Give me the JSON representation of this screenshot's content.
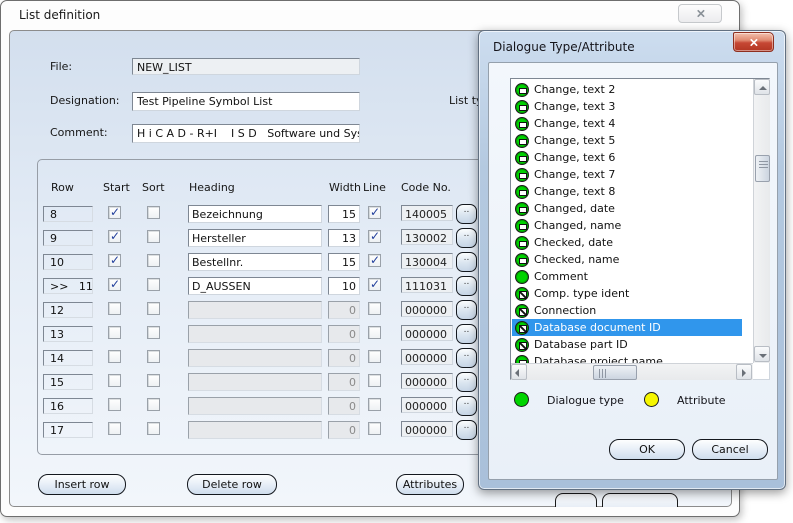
{
  "main_dialog": {
    "title": "List definition",
    "fields": {
      "file_label": "File:",
      "file_value": "NEW_LIST",
      "designation_label": "Designation:",
      "designation_value": "Test Pipeline Symbol List",
      "comment_label": "Comment:",
      "comment_value": "H i C A D - R+I    I S D   Software und System",
      "list_type_label": "List typ"
    },
    "table": {
      "headers": {
        "row": "Row",
        "start": "Start",
        "sort": "Sort",
        "heading": "Heading",
        "width": "Width",
        "line": "Line",
        "code": "Code No."
      },
      "code_button_label": "..",
      "rows": [
        {
          "row": "8",
          "marker": "",
          "start": true,
          "sort": false,
          "heading": "Bezeichnung",
          "width": "15",
          "line": true,
          "code": "140005",
          "enabled": true
        },
        {
          "row": "9",
          "marker": "",
          "start": true,
          "sort": false,
          "heading": "Hersteller",
          "width": "13",
          "line": true,
          "code": "130002",
          "enabled": true
        },
        {
          "row": "10",
          "marker": "",
          "start": true,
          "sort": false,
          "heading": "Bestellnr.",
          "width": "15",
          "line": true,
          "code": "130004",
          "enabled": true
        },
        {
          "row": "11",
          "marker": ">>",
          "start": true,
          "sort": false,
          "heading": "D_AUSSEN",
          "width": "10",
          "line": true,
          "code": "111031",
          "enabled": true
        },
        {
          "row": "12",
          "marker": "",
          "start": false,
          "sort": false,
          "heading": "",
          "width": "0",
          "line": false,
          "code": "000000",
          "enabled": false
        },
        {
          "row": "13",
          "marker": "",
          "start": false,
          "sort": false,
          "heading": "",
          "width": "0",
          "line": false,
          "code": "000000",
          "enabled": false
        },
        {
          "row": "14",
          "marker": "",
          "start": false,
          "sort": false,
          "heading": "",
          "width": "0",
          "line": false,
          "code": "000000",
          "enabled": false
        },
        {
          "row": "15",
          "marker": "",
          "start": false,
          "sort": false,
          "heading": "",
          "width": "0",
          "line": false,
          "code": "000000",
          "enabled": false
        },
        {
          "row": "16",
          "marker": "",
          "start": false,
          "sort": false,
          "heading": "",
          "width": "0",
          "line": false,
          "code": "000000",
          "enabled": false
        },
        {
          "row": "17",
          "marker": "",
          "start": false,
          "sort": false,
          "heading": "",
          "width": "0",
          "line": false,
          "code": "000000",
          "enabled": false
        }
      ]
    },
    "buttons": {
      "insert_row": "Insert row",
      "delete_row": "Delete row",
      "attributes": "Attributes"
    }
  },
  "attribute_dialog": {
    "title": "Dialogue Type/Attribute",
    "list_items": [
      {
        "label": "Change, text 2",
        "icon": "dialog-window"
      },
      {
        "label": "Change, text 3",
        "icon": "dialog-window"
      },
      {
        "label": "Change, text 4",
        "icon": "dialog-window"
      },
      {
        "label": "Change, text 5",
        "icon": "dialog-window"
      },
      {
        "label": "Change, text 6",
        "icon": "dialog-window"
      },
      {
        "label": "Change, text 7",
        "icon": "dialog-window"
      },
      {
        "label": "Change, text 8",
        "icon": "dialog-window"
      },
      {
        "label": "Changed, date",
        "icon": "dialog-window"
      },
      {
        "label": "Changed, name",
        "icon": "dialog-window"
      },
      {
        "label": "Checked, date",
        "icon": "dialog-window"
      },
      {
        "label": "Checked, name",
        "icon": "dialog-window"
      },
      {
        "label": "Comment",
        "icon": "dialog-plain"
      },
      {
        "label": "Comp. type ident",
        "icon": "dialog-slash"
      },
      {
        "label": "Connection",
        "icon": "dialog-slash"
      },
      {
        "label": "Database document ID",
        "icon": "dialog-slash",
        "selected": true
      },
      {
        "label": "Database part ID",
        "icon": "dialog-slash"
      },
      {
        "label": "Database project name",
        "icon": "dialog-window"
      }
    ],
    "legend": [
      {
        "label": "Dialogue type",
        "color": "#00d400"
      },
      {
        "label": "Attribute",
        "color": "#f6f600"
      }
    ],
    "buttons": {
      "ok": "OK",
      "cancel": "Cancel"
    }
  },
  "colors": {
    "selection": "#3096ec",
    "selection_text": "#ffffff"
  }
}
